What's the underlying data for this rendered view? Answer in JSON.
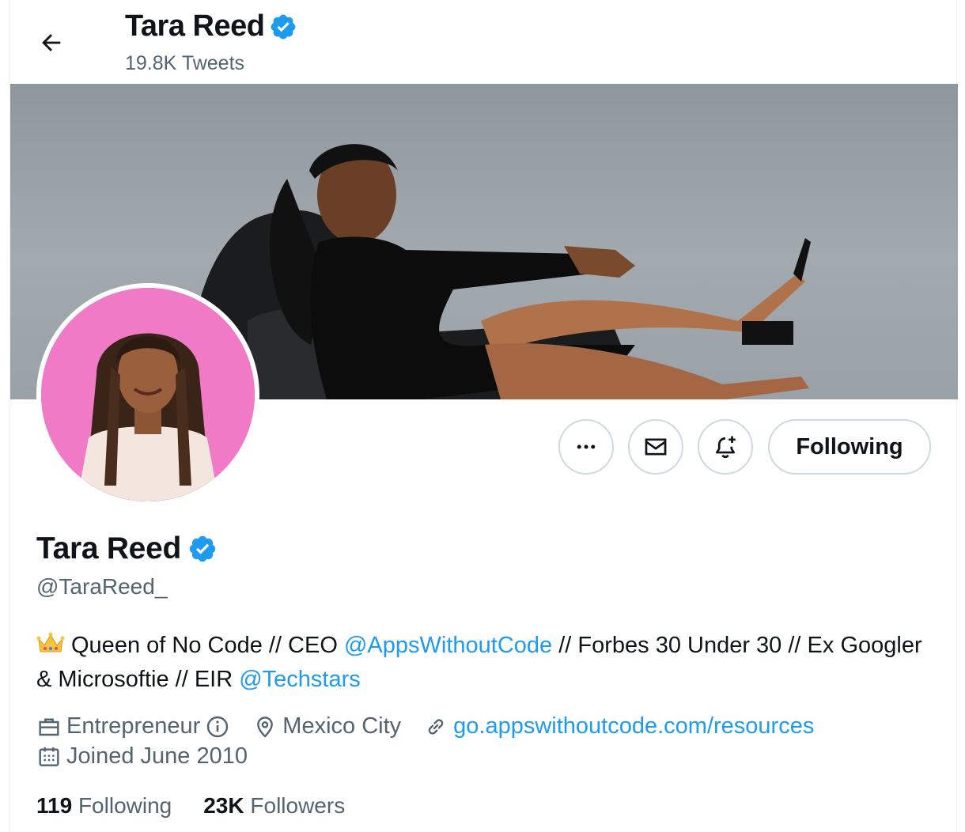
{
  "header": {
    "back_icon": "arrow-left-icon",
    "name": "Tara Reed",
    "tweets_count": "19.8K Tweets"
  },
  "colors": {
    "verified": "#1d9bf0",
    "link": "#1d9bf0",
    "secondary_text": "#536471",
    "avatar_background": "#f07ac6"
  },
  "actions": {
    "more_icon": "more-dots-icon",
    "message_icon": "envelope-icon",
    "notify_icon": "bell-plus-icon",
    "following_label": "Following"
  },
  "profile": {
    "name": "Tara Reed",
    "handle": "@TaraReed_",
    "bio": {
      "emoji": "crown-icon",
      "part1": "Queen of No Code // CEO ",
      "mention1": "@AppsWithoutCode",
      "part2": " // Forbes 30 Under 30 // Ex Googler & Microsoftie // EIR ",
      "mention2": "@Techstars"
    },
    "meta": {
      "category": "Entrepreneur",
      "location": "Mexico City",
      "url": "go.appswithoutcode.com/resources",
      "joined": "Joined June 2010"
    },
    "stats": {
      "following_count": "119",
      "following_label": "Following",
      "followers_count": "23K",
      "followers_label": "Followers"
    }
  }
}
